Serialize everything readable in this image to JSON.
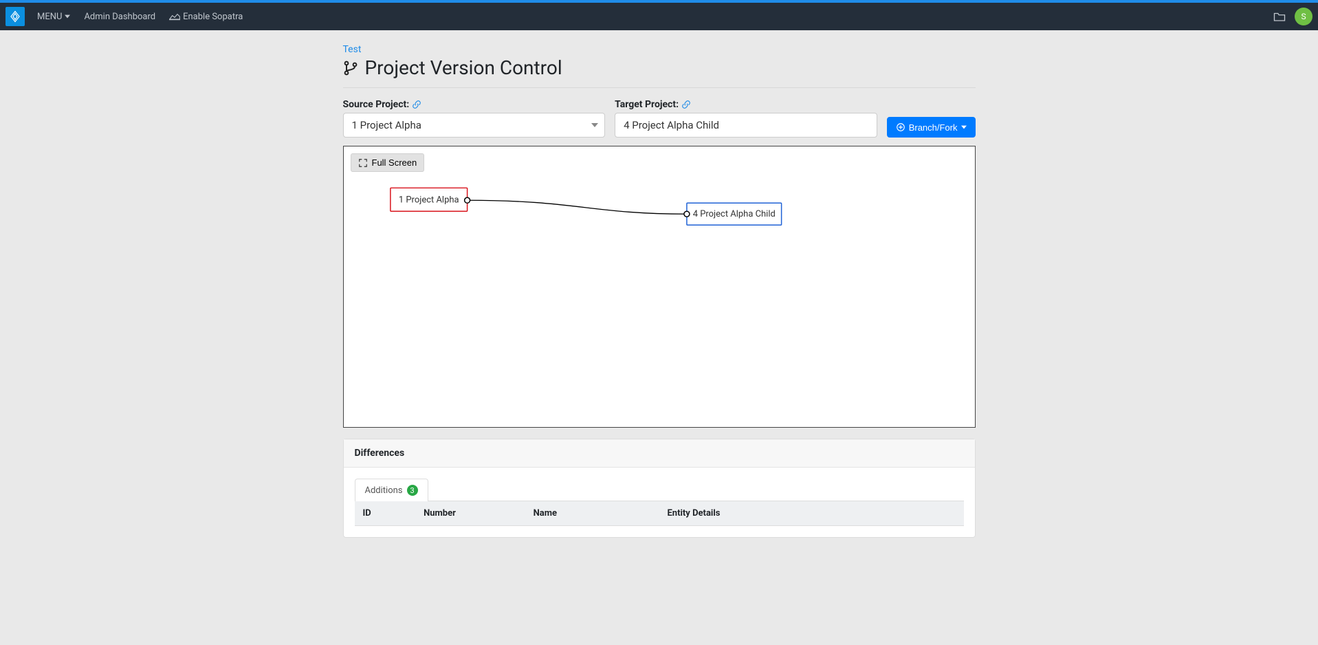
{
  "nav": {
    "menu_label": "MENU",
    "dashboard_label": "Admin Dashboard",
    "sopatra_label": "Enable Sopatra",
    "avatar_initial": "S"
  },
  "breadcrumb": {
    "parent": "Test"
  },
  "page_title": "Project Version Control",
  "form": {
    "source_label": "Source Project:",
    "source_value": "1 Project Alpha",
    "target_label": "Target Project:",
    "target_value": "4 Project Alpha Child",
    "branch_button": "Branch/Fork"
  },
  "graph": {
    "fullscreen_label": "Full Screen",
    "node_a": "1 Project Alpha",
    "node_b": "4 Project Alpha Child"
  },
  "differences": {
    "panel_title": "Differences",
    "tab_additions_label": "Additions",
    "tab_additions_count": "3",
    "columns": {
      "id": "ID",
      "number": "Number",
      "name": "Name",
      "entity_details": "Entity Details"
    }
  }
}
